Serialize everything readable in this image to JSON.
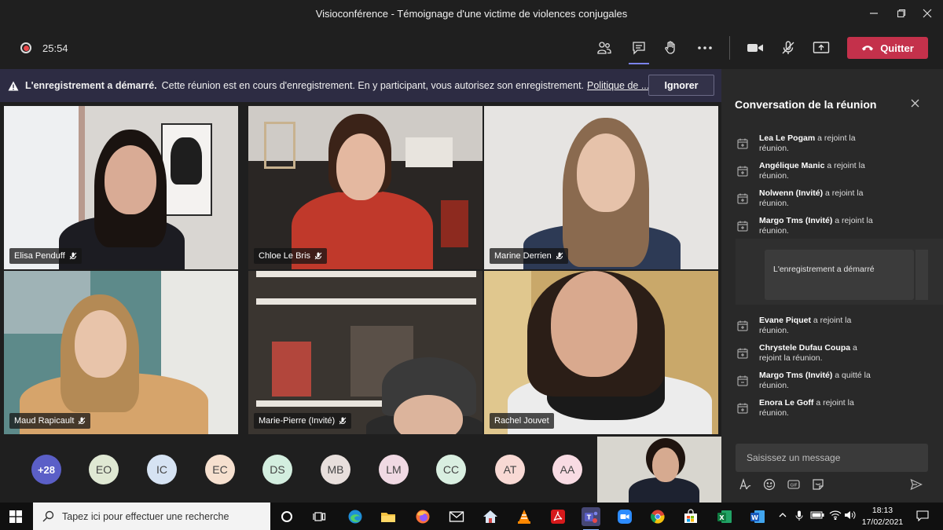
{
  "window": {
    "title": "Visioconférence - Témoignage d'une victime de violences conjugales",
    "minimize_icon": "minimize-icon",
    "maximize_icon": "maximize-icon",
    "close_icon": "close-icon"
  },
  "meeting_toolbar": {
    "elapsed_time": "25:54",
    "quit_label": "Quitter",
    "accent": "#c4314b"
  },
  "banner": {
    "bold_text": "L'enregistrement a démarré.",
    "text": "Cette réunion est en cours d'enregistrement. En y participant, vous autorisez son enregistrement.",
    "link_text": "Politique de ...",
    "dismiss_label": "Ignorer"
  },
  "participants": [
    {
      "name": "Elisa Penduff"
    },
    {
      "name": "Chloe Le Bris"
    },
    {
      "name": "Marine Derrien"
    },
    {
      "name": "Maud Rapicault"
    },
    {
      "name": "Marie-Pierre (Invité)"
    },
    {
      "name": "Rachel Jouvet"
    }
  ],
  "avatars": [
    {
      "initials": "+28",
      "color": "#5b5fc7"
    },
    {
      "initials": "EO",
      "color": "#dfe8d3"
    },
    {
      "initials": "IC",
      "color": "#d6e3f3"
    },
    {
      "initials": "EC",
      "color": "#f6e0cf"
    },
    {
      "initials": "DS",
      "color": "#d3eedf"
    },
    {
      "initials": "MB",
      "color": "#e8dfdc"
    },
    {
      "initials": "LM",
      "color": "#f0d9e3"
    },
    {
      "initials": "CC",
      "color": "#d9efe1"
    },
    {
      "initials": "AT",
      "color": "#f8d9d4"
    },
    {
      "initials": "AA",
      "color": "#f8dbe3"
    }
  ],
  "chat": {
    "title": "Conversation de la réunion",
    "events_before": [
      {
        "name": "Lea Le Pogam",
        "action": "a rejoint la réunion."
      },
      {
        "name": "Angélique Manic",
        "action": "a rejoint la réunion."
      },
      {
        "name": "Nolwenn (Invité)",
        "action": "a rejoint la réunion."
      },
      {
        "name": "Margo Tms (Invité)",
        "action": "a rejoint la réunion."
      }
    ],
    "recording_card": "L'enregistrement a démarré",
    "events_after": [
      {
        "name": "Evane Piquet",
        "action": "a rejoint la réunion."
      },
      {
        "name": "Chrystele Dufau Coupa",
        "action": "a rejoint la réunion."
      },
      {
        "name": "Margo Tms (Invité)",
        "action": "a quitté la réunion."
      },
      {
        "name": "Enora Le Goff",
        "action": "a rejoint la réunion."
      }
    ],
    "input_placeholder": "Saisissez un message"
  },
  "taskbar": {
    "search_placeholder": "Tapez ici pour effectuer une recherche",
    "time": "18:13",
    "date": "17/02/2021"
  }
}
